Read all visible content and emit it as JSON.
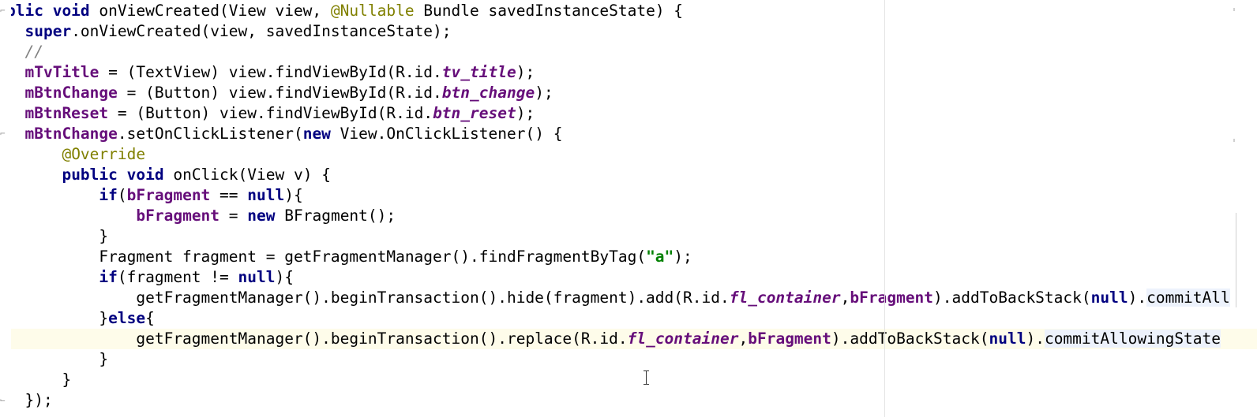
{
  "editor": {
    "lines": [
      [
        {
          "t": "blic ",
          "c": "kw"
        },
        {
          "t": "void ",
          "c": "kw"
        },
        {
          "t": "onViewCreated(View view, ",
          "c": "plain"
        },
        {
          "t": "@Nullable",
          "c": "ann"
        },
        {
          "t": " Bundle savedInstanceState) {",
          "c": "plain"
        }
      ],
      [
        {
          "t": "  ",
          "c": "plain"
        },
        {
          "t": "super",
          "c": "kw"
        },
        {
          "t": ".onViewCreated(view, savedInstanceState);",
          "c": "plain"
        }
      ],
      [
        {
          "t": "  //",
          "c": "cmt"
        }
      ],
      [
        {
          "t": "  ",
          "c": "plain"
        },
        {
          "t": "mTvTitle",
          "c": "fld"
        },
        {
          "t": " = (TextView) view.findViewById(R.id.",
          "c": "plain"
        },
        {
          "t": "tv_title",
          "c": "ifld"
        },
        {
          "t": ");",
          "c": "plain"
        }
      ],
      [
        {
          "t": "  ",
          "c": "plain"
        },
        {
          "t": "mBtnChange",
          "c": "fld"
        },
        {
          "t": " = (Button) view.findViewById(R.id.",
          "c": "plain"
        },
        {
          "t": "btn_change",
          "c": "ifld"
        },
        {
          "t": ");",
          "c": "plain"
        }
      ],
      [
        {
          "t": "  ",
          "c": "plain"
        },
        {
          "t": "mBtnReset",
          "c": "fld"
        },
        {
          "t": " = (Button) view.findViewById(R.id.",
          "c": "plain"
        },
        {
          "t": "btn_reset",
          "c": "ifld"
        },
        {
          "t": ");",
          "c": "plain"
        }
      ],
      [
        {
          "t": "  ",
          "c": "plain"
        },
        {
          "t": "mBtnChange",
          "c": "fld"
        },
        {
          "t": ".setOnClickListener(",
          "c": "plain"
        },
        {
          "t": "new",
          "c": "kw"
        },
        {
          "t": " View.OnClickListener() {",
          "c": "plain"
        }
      ],
      [
        {
          "t": "      ",
          "c": "plain"
        },
        {
          "t": "@Override",
          "c": "ann"
        }
      ],
      [
        {
          "t": "      ",
          "c": "plain"
        },
        {
          "t": "public ",
          "c": "kw"
        },
        {
          "t": "void",
          "c": "kw"
        },
        {
          "t": " onClick(View v) {",
          "c": "plain"
        }
      ],
      [
        {
          "t": "          ",
          "c": "plain"
        },
        {
          "t": "if",
          "c": "kw"
        },
        {
          "t": "(",
          "c": "plain"
        },
        {
          "t": "bFragment",
          "c": "fld"
        },
        {
          "t": " == ",
          "c": "plain"
        },
        {
          "t": "null",
          "c": "kw"
        },
        {
          "t": "){",
          "c": "plain"
        }
      ],
      [
        {
          "t": "              ",
          "c": "plain"
        },
        {
          "t": "bFragment",
          "c": "fld"
        },
        {
          "t": " = ",
          "c": "plain"
        },
        {
          "t": "new",
          "c": "kw"
        },
        {
          "t": " BFragment();",
          "c": "plain"
        }
      ],
      [
        {
          "t": "          }",
          "c": "plain"
        }
      ],
      [
        {
          "t": "          Fragment fragment = getFragmentManager().findFragmentByTag(",
          "c": "plain"
        },
        {
          "t": "\"a\"",
          "c": "str"
        },
        {
          "t": ");",
          "c": "plain"
        }
      ],
      [
        {
          "t": "          ",
          "c": "plain"
        },
        {
          "t": "if",
          "c": "kw"
        },
        {
          "t": "(fragment != ",
          "c": "plain"
        },
        {
          "t": "null",
          "c": "kw"
        },
        {
          "t": "){",
          "c": "plain"
        }
      ],
      [
        {
          "t": "              getFragmentManager().beginTransaction().hide(fragment).add(R.id.",
          "c": "plain"
        },
        {
          "t": "fl_container",
          "c": "ifld"
        },
        {
          "t": ",",
          "c": "plain"
        },
        {
          "t": "bFragment",
          "c": "fld"
        },
        {
          "t": ").addToBackStack(",
          "c": "plain"
        },
        {
          "t": "null",
          "c": "kw"
        },
        {
          "t": ").",
          "c": "plain"
        },
        {
          "t": "commitAll",
          "c": "plain hl"
        }
      ],
      [
        {
          "t": "          }",
          "c": "plain"
        },
        {
          "t": "else",
          "c": "kw"
        },
        {
          "t": "{",
          "c": "plain"
        }
      ],
      [
        {
          "t": "              getFragmentManager().beginTransaction().replace(R.id.",
          "c": "plain"
        },
        {
          "t": "fl_container",
          "c": "ifld"
        },
        {
          "t": ",",
          "c": "plain"
        },
        {
          "t": "bFragment",
          "c": "fld"
        },
        {
          "t": ").addToBackStack(",
          "c": "plain"
        },
        {
          "t": "null",
          "c": "kw"
        },
        {
          "t": ").",
          "c": "plain"
        },
        {
          "t": "commitAllowingState",
          "c": "plain hl"
        }
      ],
      [
        {
          "t": "          }",
          "c": "plain"
        }
      ],
      [
        {
          "t": "      }",
          "c": "plain"
        }
      ],
      [
        {
          "t": "  });",
          "c": "plain"
        }
      ]
    ],
    "current_line": 16
  }
}
